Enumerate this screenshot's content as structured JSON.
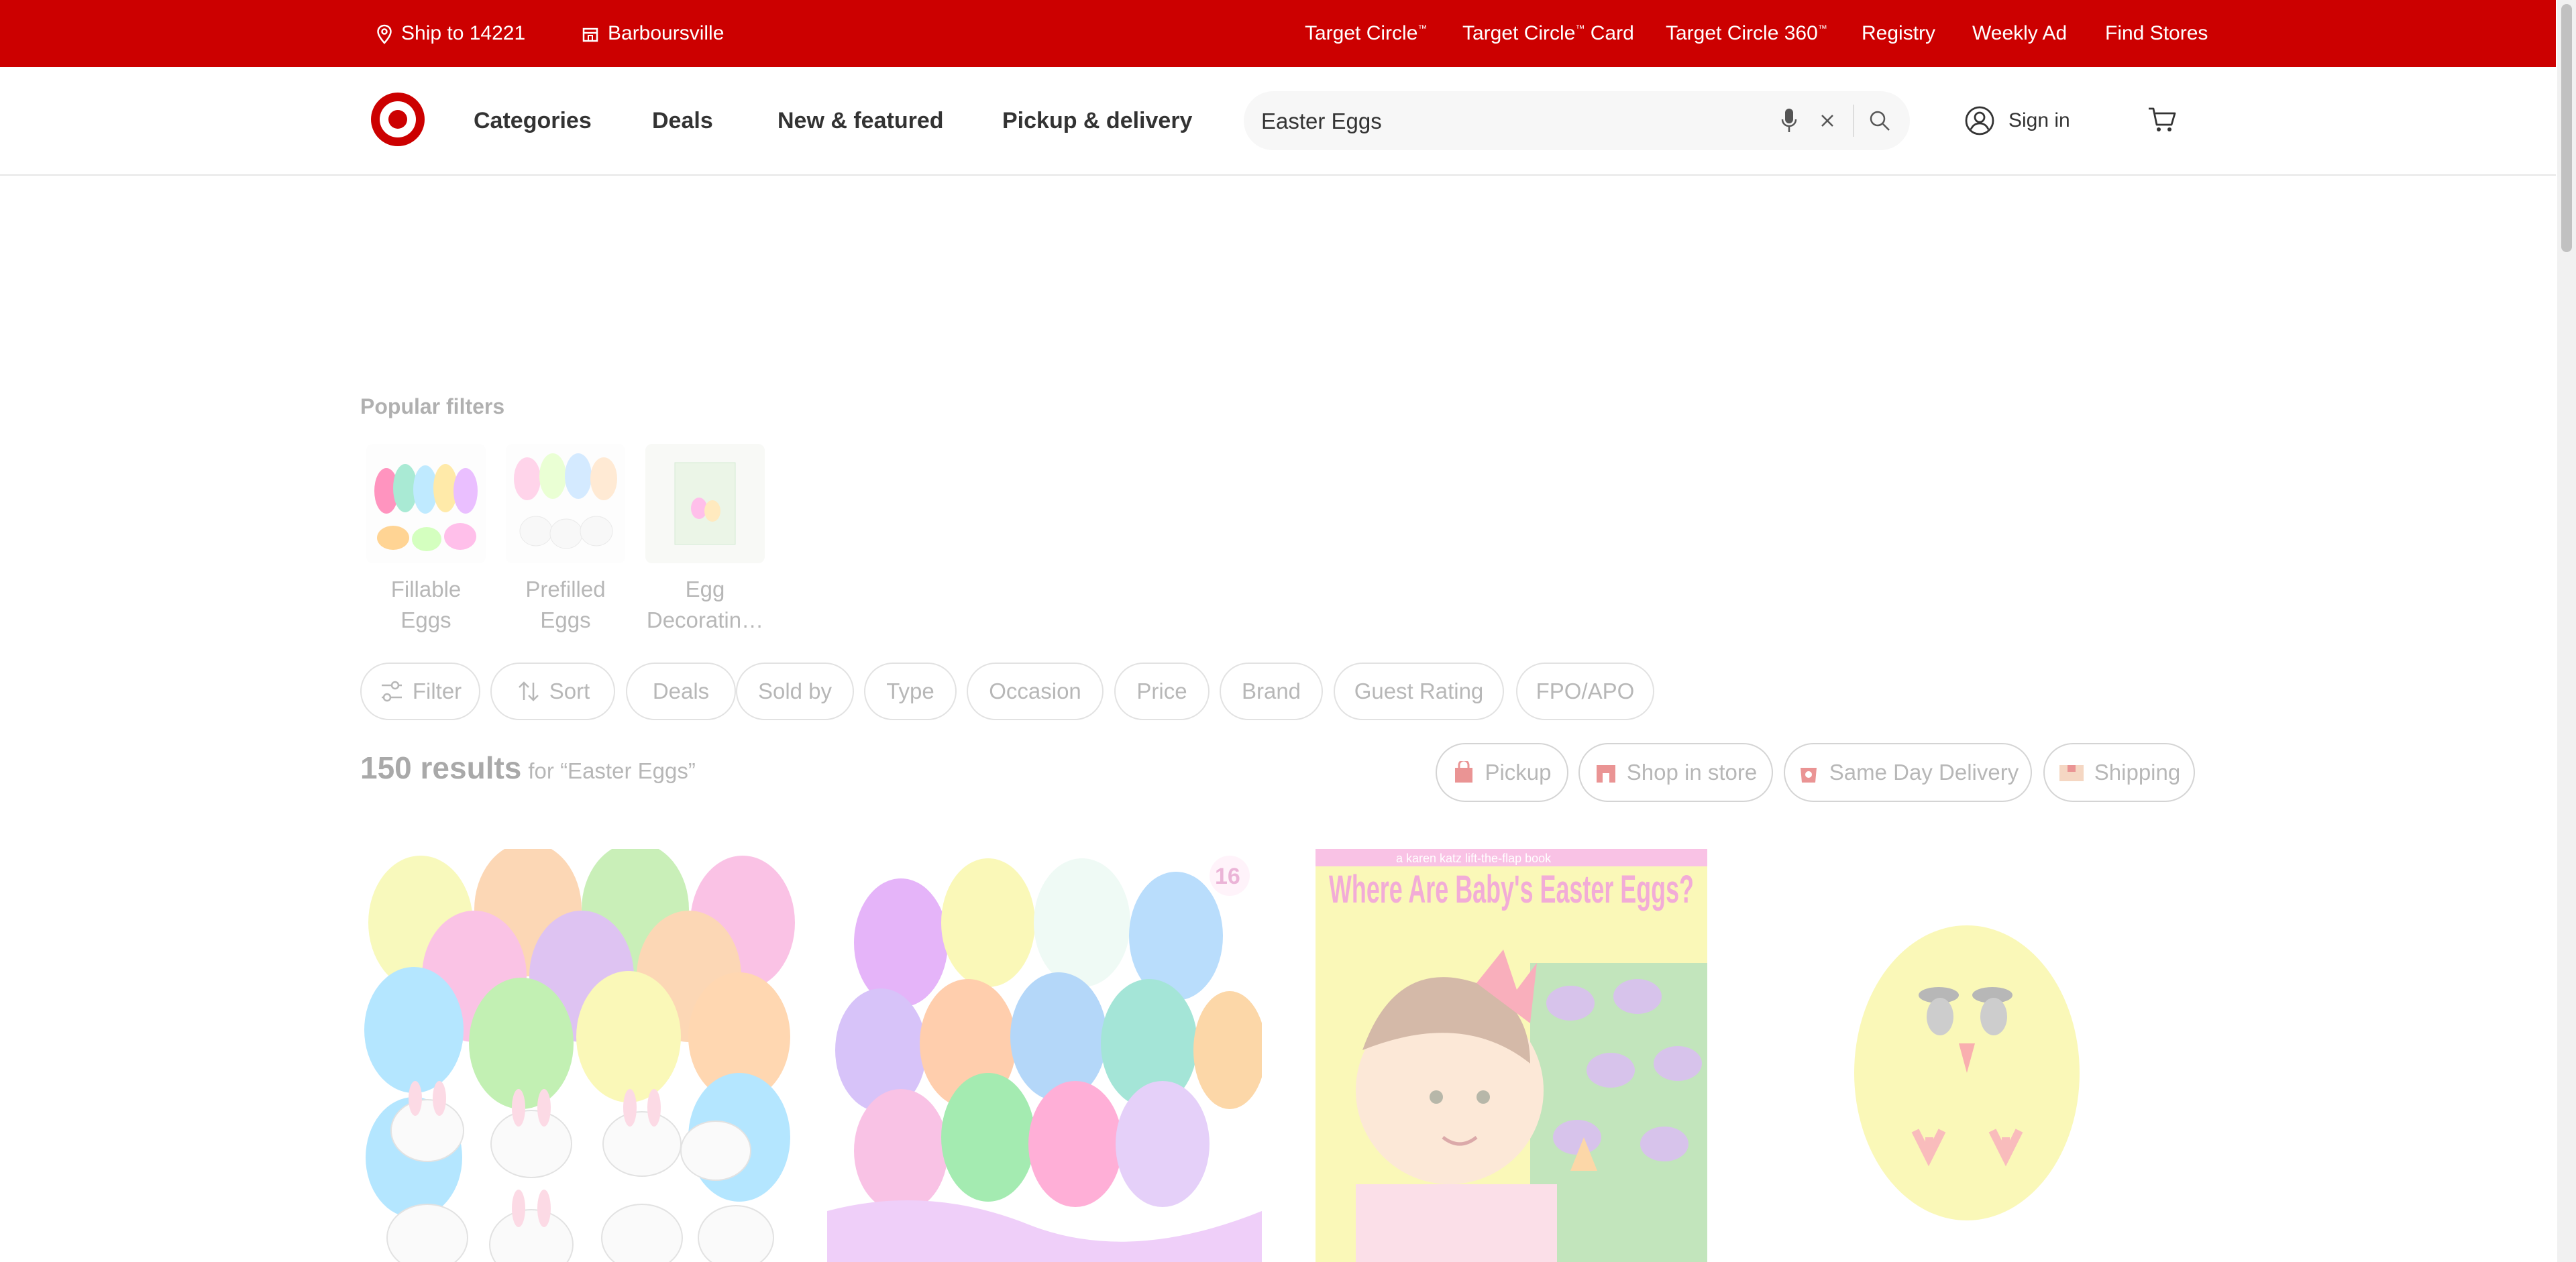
{
  "topbar": {
    "ship_to": "Ship to 14221",
    "store": "Barboursville",
    "links": [
      "Target Circle",
      "Target Circle",
      "Target Circle 360",
      "Registry",
      "Weekly Ad",
      "Find Stores"
    ],
    "link_suffixes": [
      "™",
      "™ Card",
      "™",
      "",
      "",
      ""
    ],
    "bg_color": "#cc0000"
  },
  "header": {
    "nav": [
      "Categories",
      "Deals",
      "New & featured",
      "Pickup & delivery"
    ],
    "search_value": "Easter Eggs",
    "sign_in": "Sign in",
    "icons": [
      "target-logo",
      "microphone-icon",
      "clear-icon",
      "search-icon",
      "account-icon",
      "cart-icon"
    ]
  },
  "popular_filters": {
    "title": "Popular filters",
    "items": [
      {
        "label": "Fillable Eggs"
      },
      {
        "label": "Prefilled Eggs"
      },
      {
        "label": "Egg Decoratin…"
      }
    ]
  },
  "filter_chips": [
    "Filter",
    "Sort",
    "Deals",
    "Sold by",
    "Type",
    "Occasion",
    "Price",
    "Brand",
    "Guest Rating",
    "FPO/APO"
  ],
  "results": {
    "count": "150 results",
    "query": "for “Easter Eggs”"
  },
  "fulfillment_chips": [
    "Pickup",
    "Shop in store",
    "Same Day Delivery",
    "Shipping"
  ],
  "products": [
    {
      "image": "pastel-eggs-with-bunny-cars"
    },
    {
      "image": "clear-eggs-with-slime",
      "badge": "16"
    },
    {
      "image": "book-cover",
      "book_top": "a karen katz lift-the-flap book",
      "book_title": "Where Are Baby's Easter Eggs?"
    },
    {
      "image": "yellow-chick-egg"
    }
  ]
}
